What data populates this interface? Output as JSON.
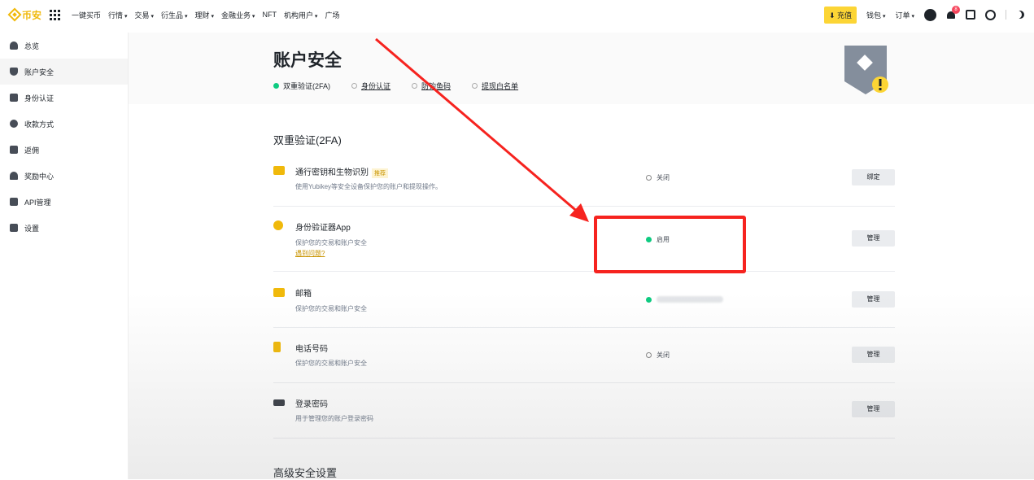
{
  "topbar": {
    "brand": "币安",
    "nav": [
      "一键买币",
      "行情",
      "交易",
      "衍生品",
      "理财",
      "金融业务",
      "NFT",
      "机构用户",
      "广场"
    ],
    "deposit_label": "充值",
    "wallet_label": "钱包",
    "orders_label": "订单",
    "notification_count": "8"
  },
  "sidebar": {
    "items": [
      {
        "label": "总览",
        "icon": "user-icon"
      },
      {
        "label": "账户安全",
        "icon": "shield-icon",
        "active": true
      },
      {
        "label": "身份认证",
        "icon": "id-card-icon"
      },
      {
        "label": "收款方式",
        "icon": "payment-icon"
      },
      {
        "label": "返佣",
        "icon": "referral-icon"
      },
      {
        "label": "奖励中心",
        "icon": "reward-icon"
      },
      {
        "label": "API管理",
        "icon": "api-icon"
      },
      {
        "label": "设置",
        "icon": "settings-icon"
      }
    ]
  },
  "page": {
    "title": "账户安全",
    "steps": [
      {
        "label": "双重验证(2FA)",
        "done": true
      },
      {
        "label": "身份认证",
        "done": false
      },
      {
        "label": "防钓鱼码",
        "done": false
      },
      {
        "label": "提现白名单",
        "done": false
      }
    ]
  },
  "twofa": {
    "section_title": "双重验证(2FA)",
    "rows": [
      {
        "title": "通行密钥和生物识别",
        "tag": "推荐",
        "desc": "使用Yubikey等安全设备保护您的账户和提现操作。",
        "status": "关闭",
        "status_on": false,
        "button": "绑定"
      },
      {
        "title": "身份验证器App",
        "desc": "保护您的交易和账户安全",
        "link": "遇到问题?",
        "status": "启用",
        "status_on": true,
        "button": "管理"
      },
      {
        "title": "邮箱",
        "desc": "保护您的交易和账户安全",
        "status": "",
        "status_on": true,
        "button": "管理"
      },
      {
        "title": "电话号码",
        "desc": "保护您的交易和账户安全",
        "status": "关闭",
        "status_on": false,
        "button": "管理"
      },
      {
        "title": "登录密码",
        "desc": "用于管理您的账户登录密码",
        "status": "",
        "status_on": null,
        "button": "管理"
      }
    ]
  },
  "advanced": {
    "section_title": "高级安全设置"
  },
  "colors": {
    "brand": "#f0b90b",
    "annotation_red": "#f6231f",
    "status_green": "#0ecb81"
  }
}
